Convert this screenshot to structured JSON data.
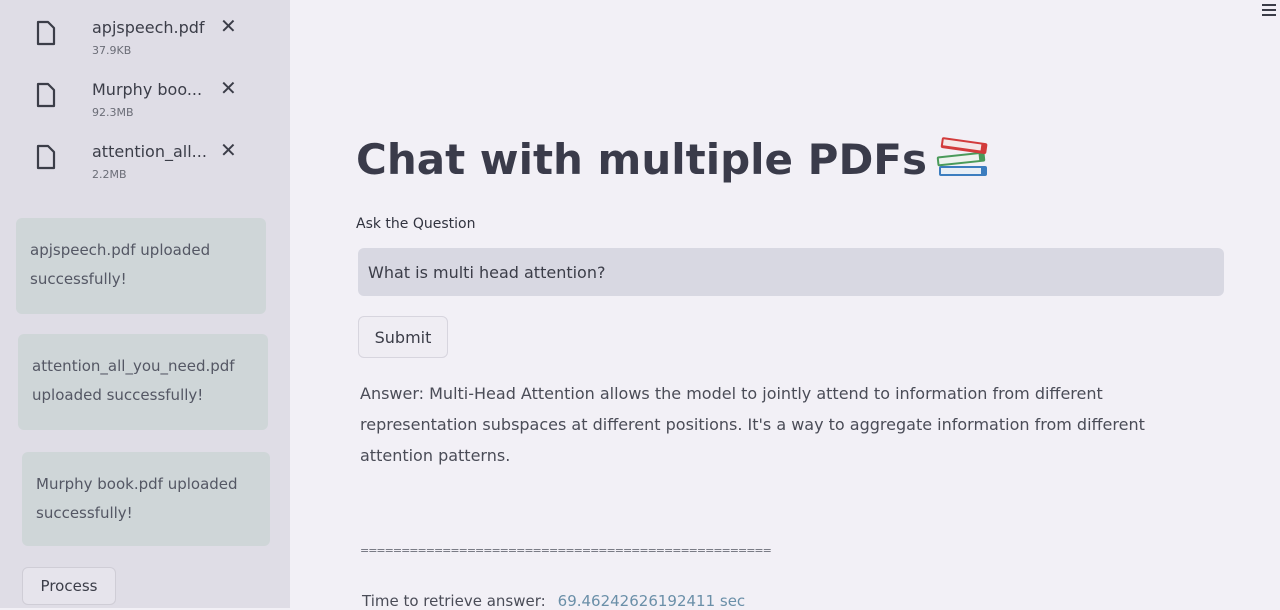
{
  "sidebar": {
    "files": [
      {
        "name": "apjspeech.pdf",
        "size": "37.9KB",
        "icon": "file-icon",
        "remove_icon": "✕"
      },
      {
        "name": "Murphy boo...",
        "size": "92.3MB",
        "icon": "file-icon",
        "remove_icon": "✕"
      },
      {
        "name": "attention_all...",
        "size": "2.2MB",
        "icon": "file-icon",
        "remove_icon": "✕"
      }
    ],
    "alerts": [
      "apjspeech.pdf uploaded successfully!",
      "attention_all_you_need.pdf uploaded successfully!",
      "Murphy book.pdf uploaded successfully!"
    ],
    "process_label": "Process"
  },
  "main": {
    "title": "Chat with multiple PDFs",
    "title_icon": "books-icon",
    "question_label": "Ask the Question",
    "question_value": "What is multi head attention?",
    "submit_label": "Submit",
    "answer": "Answer: Multi-Head Attention allows the model to jointly attend to information from different representation subspaces at different positions. It's a way to aggregate information from different attention patterns.",
    "divider": "==================================================",
    "time_label": "Time to retrieve answer:",
    "time_value": "69.46242626192411 sec"
  },
  "colors": {
    "sidebar_bg": "#dfdde6",
    "main_bg": "#f2f0f6",
    "alert_bg": "#cfd6d8",
    "input_bg": "#d8d8e2",
    "time_value": "#6a8fa8"
  }
}
